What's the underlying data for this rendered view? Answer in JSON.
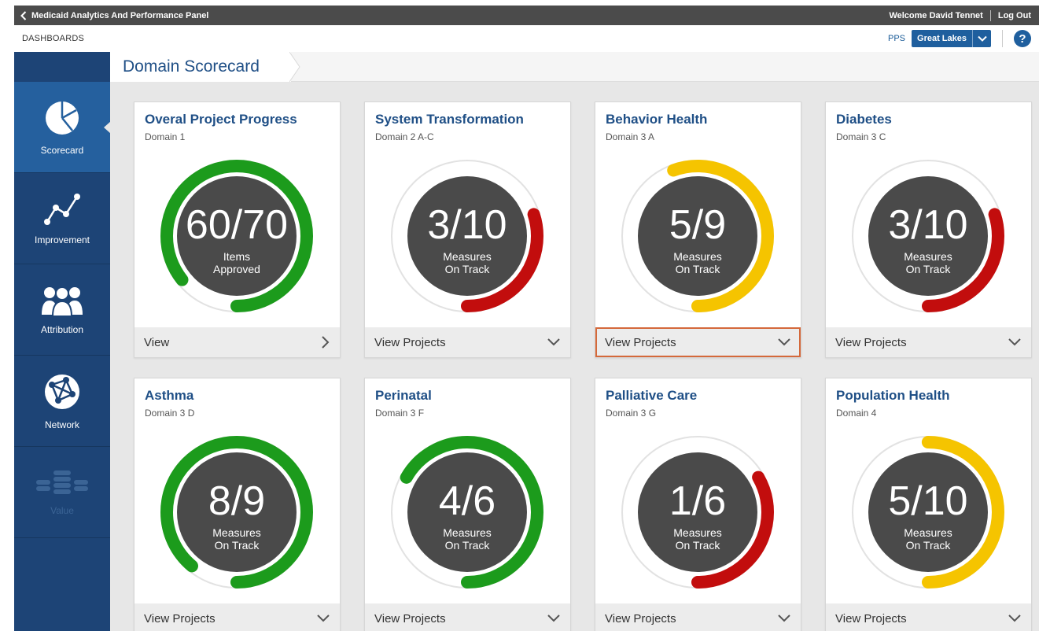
{
  "header": {
    "app_title": "Medicaid Analytics And Performance Panel",
    "welcome": "Welcome David Tennet",
    "logout": "Log Out"
  },
  "subheader": {
    "section": "DASHBOARDS",
    "pps_label": "PPS",
    "pps_value": "Great Lakes",
    "help": "?"
  },
  "sidebar": {
    "items": [
      {
        "label": "Scorecard",
        "icon": "pie-chart-icon",
        "active": true
      },
      {
        "label": "Improvement",
        "icon": "line-graph-icon"
      },
      {
        "label": "Attribution",
        "icon": "people-icon"
      },
      {
        "label": "Network",
        "icon": "network-globe-icon"
      },
      {
        "label": "Value",
        "icon": "coins-icon",
        "disabled": true
      }
    ]
  },
  "page": {
    "title": "Domain Scorecard"
  },
  "colors": {
    "green": "#1c9b1c",
    "red": "#c20d0d",
    "yellow": "#f5c400",
    "dark": "#4a4a4a",
    "brand": "#1f4f86"
  },
  "cards": [
    {
      "title": "Overal Project Progress",
      "subtitle": "Domain 1",
      "value": "60/70",
      "label1": "Items",
      "label2": "Approved",
      "progress": 0.857,
      "color": "green",
      "footer": "View",
      "footer_icon": "chevron-right-icon"
    },
    {
      "title": "System Transformation",
      "subtitle": "Domain 2 A-C",
      "value": "3/10",
      "label1": "Measures",
      "label2": "On Track",
      "progress": 0.3,
      "color": "red",
      "footer": "View Projects",
      "footer_icon": "chevron-down-icon"
    },
    {
      "title": "Behavior Health",
      "subtitle": "Domain 3 A",
      "value": "5/9",
      "label1": "Measures",
      "label2": "On Track",
      "progress": 0.556,
      "color": "yellow",
      "footer": "View Projects",
      "footer_icon": "chevron-down-icon",
      "highlighted": true
    },
    {
      "title": "Diabetes",
      "subtitle": "Domain 3 C",
      "value": "3/10",
      "label1": "Measures",
      "label2": "On Track",
      "progress": 0.3,
      "color": "red",
      "footer": "View Projects",
      "footer_icon": "chevron-down-icon"
    },
    {
      "title": "Asthma",
      "subtitle": "Domain 3 D",
      "value": "8/9",
      "label1": "Measures",
      "label2": "On Track",
      "progress": 0.889,
      "color": "green",
      "footer": "View Projects",
      "footer_icon": "chevron-down-icon"
    },
    {
      "title": "Perinatal",
      "subtitle": "Domain 3 F",
      "value": "4/6",
      "label1": "Measures",
      "label2": "On Track",
      "progress": 0.667,
      "color": "green",
      "footer": "View Projects",
      "footer_icon": "chevron-down-icon"
    },
    {
      "title": "Palliative Care",
      "subtitle": "Domain 3 G",
      "value": "1/6",
      "label1": "Measures",
      "label2": "On Track",
      "progress": 0.333,
      "color": "red",
      "footer": "View Projects",
      "footer_icon": "chevron-down-icon"
    },
    {
      "title": "Population Health",
      "subtitle": "Domain 4",
      "value": "5/10",
      "label1": "Measures",
      "label2": "On Track",
      "progress": 0.5,
      "color": "yellow",
      "footer": "View Projects",
      "footer_icon": "chevron-down-icon"
    }
  ]
}
